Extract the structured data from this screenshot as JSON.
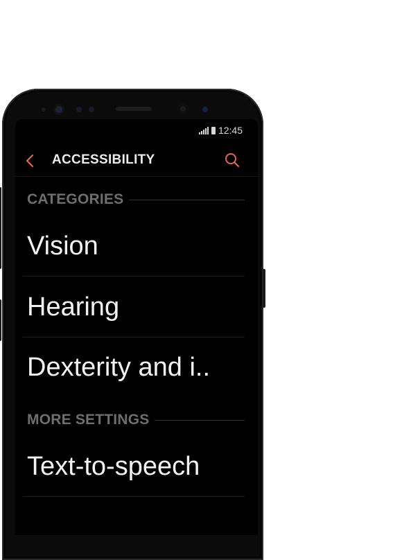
{
  "status_bar": {
    "time": "12:45"
  },
  "app_bar": {
    "title": "ACCESSIBILITY",
    "back_icon": "back-chevron-icon",
    "search_icon": "search-icon"
  },
  "sections": [
    {
      "header": "CATEGORIES",
      "items": [
        "Vision",
        "Hearing",
        "Dexterity and i.."
      ]
    },
    {
      "header": "MORE SETTINGS",
      "items": [
        "Text-to-speech"
      ]
    }
  ],
  "colors": {
    "accent": "#e4684e",
    "background": "#000000",
    "text": "#f2f2f2",
    "section_header": "#6e6e6e"
  }
}
